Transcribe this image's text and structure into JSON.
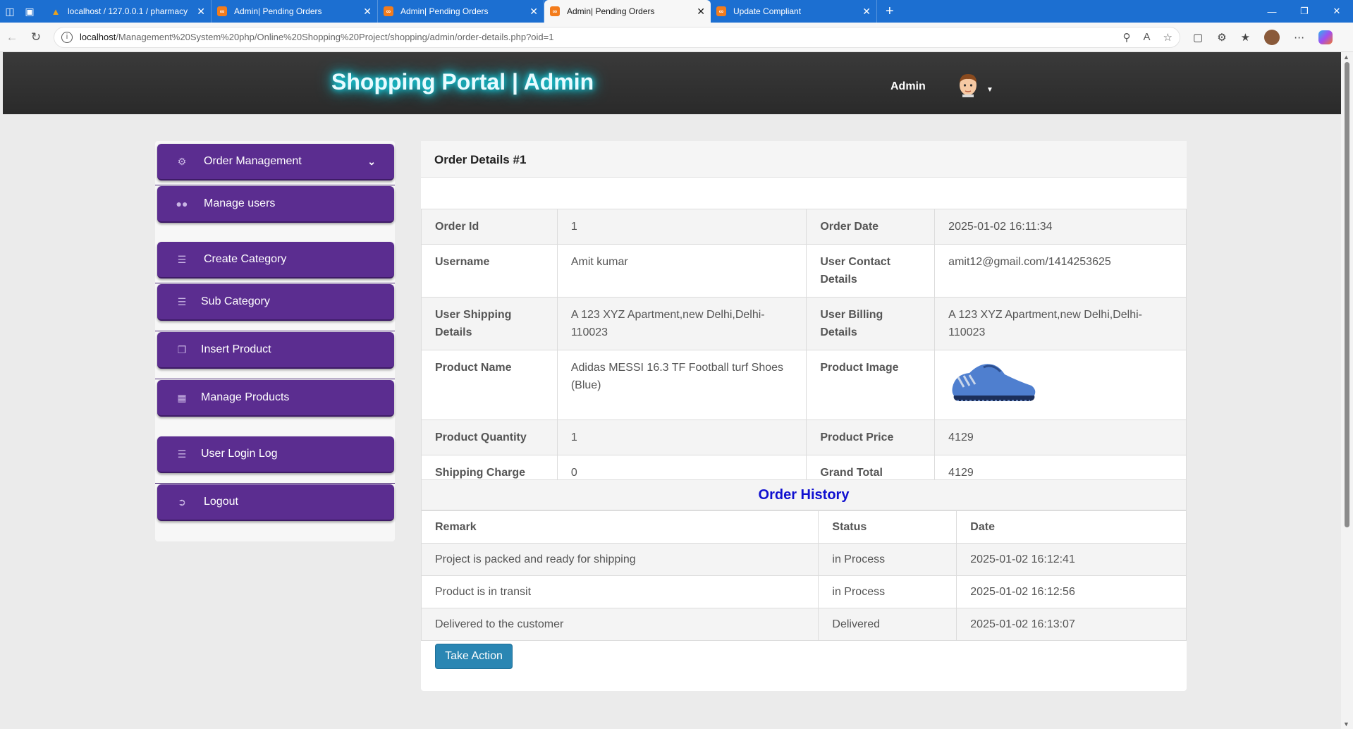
{
  "browser": {
    "tabs": [
      {
        "title": "localhost / 127.0.0.1 / pharmacy",
        "active": false,
        "favicon": "phpmyadmin-icon"
      },
      {
        "title": "Admin| Pending Orders",
        "active": false,
        "favicon": "xampp-icon"
      },
      {
        "title": "Admin| Pending Orders",
        "active": false,
        "favicon": "xampp-icon"
      },
      {
        "title": "Admin| Pending Orders",
        "active": true,
        "favicon": "xampp-icon"
      },
      {
        "title": "Update Compliant",
        "active": false,
        "favicon": "xampp-icon"
      }
    ],
    "url_host": "localhost",
    "url_path": "/Management%20System%20php/Online%20Shopping%20Project/shopping/admin/order-details.php?oid=1"
  },
  "header": {
    "brand": "Shopping Portal | Admin",
    "admin_name": "Admin",
    "brand_glow_color": "#14d7e8"
  },
  "sidebar": {
    "accent_color": "#5b2d90",
    "items": [
      {
        "label": "Order Management",
        "icon": "gear-icon"
      },
      {
        "label": "Manage users",
        "icon": "users-icon"
      },
      {
        "label": "Create Category",
        "icon": "tasks-icon"
      },
      {
        "label": "Sub Category",
        "icon": "tasks-icon"
      },
      {
        "label": "Insert Product",
        "icon": "paste-icon"
      },
      {
        "label": "Manage Products",
        "icon": "table-icon"
      },
      {
        "label": "User Login Log",
        "icon": "tasks-icon"
      },
      {
        "label": "Logout",
        "icon": "signout-icon"
      }
    ]
  },
  "order": {
    "title": "Order Details #1",
    "labels": {
      "order_id": "Order Id",
      "order_date": "Order Date",
      "username": "Username",
      "contact": "User Contact Details",
      "shipping": "User Shipping Details",
      "billing": "User Billing Details",
      "product_name": "Product Name",
      "product_image": "Product Image",
      "quantity": "Product Quantity",
      "price": "Product Price",
      "shipping_charge": "Shipping Charge",
      "grand_total": "Grand Total"
    },
    "values": {
      "order_id": "1",
      "order_date": "2025-01-02 16:11:34",
      "username": "Amit kumar",
      "contact": "amit12@gmail.com/1414253625",
      "shipping": "A 123 XYZ Apartment,new Delhi,Delhi-110023",
      "billing": "A 123 XYZ Apartment,new Delhi,Delhi-110023",
      "product_name": "Adidas MESSI 16.3 TF Football turf Shoes (Blue)",
      "quantity": "1",
      "price": "4129",
      "shipping_charge": "0",
      "grand_total": "4129"
    }
  },
  "history": {
    "title": "Order History",
    "title_color": "#1010d0",
    "columns": [
      "Remark",
      "Status",
      "Date"
    ],
    "rows": [
      [
        "Project is packed and ready for shipping",
        "in Process",
        "2025-01-02 16:12:41"
      ],
      [
        "Product is in transit",
        "in Process",
        "2025-01-02 16:12:56"
      ],
      [
        "Delivered to the customer",
        "Delivered",
        "2025-01-02 16:13:07"
      ]
    ],
    "action_label": "Take Action"
  }
}
